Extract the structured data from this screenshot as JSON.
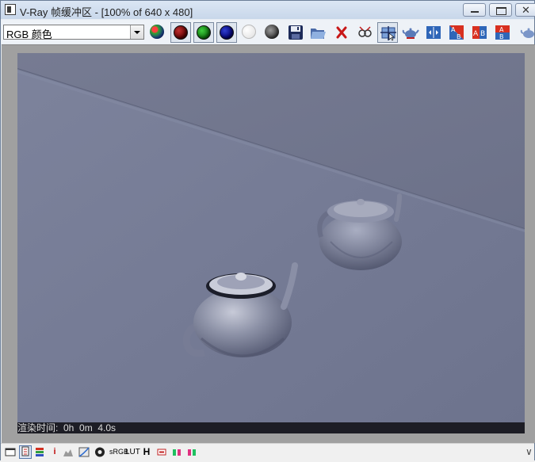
{
  "window": {
    "title": "V-Ray 帧缓冲区 - [100% of 640 x 480]"
  },
  "toolbar": {
    "channel_select": {
      "value": "RGB 颜色"
    },
    "buttons": [
      {
        "name": "rgb-channels-icon",
        "color": "#2c6b3a"
      },
      {
        "name": "red-channel-icon",
        "color": "#8b0000"
      },
      {
        "name": "green-channel-icon",
        "color": "#0a7a0a"
      },
      {
        "name": "blue-channel-icon",
        "color": "#00007a"
      },
      {
        "name": "white-mono-icon",
        "color": "#ffffff"
      },
      {
        "name": "alpha-channel-icon",
        "color": "#555555"
      },
      {
        "name": "save-icon"
      },
      {
        "name": "open-folder-icon"
      },
      {
        "name": "clear-icon"
      },
      {
        "name": "track-mouse-icon"
      },
      {
        "name": "region-render-icon"
      },
      {
        "name": "render-teapot-icon"
      },
      {
        "name": "ab-compare-icon"
      },
      {
        "name": "history-a-icon"
      },
      {
        "name": "history-b-icon"
      },
      {
        "name": "history-ab-icon"
      },
      {
        "name": "overflow-teapot-icon"
      }
    ]
  },
  "status": {
    "render_time": "渲染时间:  0h  0m  4.0s"
  },
  "bottombar": {
    "buttons": [
      {
        "name": "display-window-icon",
        "label": ""
      },
      {
        "name": "color-corrections-icon",
        "label": ""
      },
      {
        "name": "layers-icon",
        "label": ""
      },
      {
        "name": "info-icon",
        "label": "i"
      },
      {
        "name": "levels-icon",
        "label": ""
      },
      {
        "name": "curve-icon",
        "label": ""
      },
      {
        "name": "exposure-icon",
        "label": ""
      },
      {
        "name": "srgb-toggle",
        "label": "sRGB"
      },
      {
        "name": "lut-toggle",
        "label": "LUT"
      },
      {
        "name": "histogram-toggle",
        "label": "H"
      },
      {
        "name": "red-pixel-icon",
        "label": ""
      },
      {
        "name": "clamp-color-icon",
        "label": ""
      },
      {
        "name": "stereo-icon",
        "label": ""
      }
    ]
  }
}
